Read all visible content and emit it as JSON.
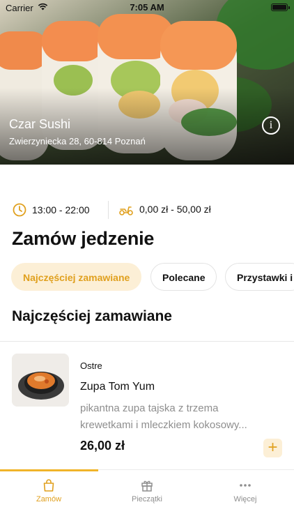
{
  "status_bar": {
    "carrier": "Carrier",
    "time": "7:05 AM"
  },
  "restaurant": {
    "name": "Czar Sushi",
    "address": "Zwierzyniecka 28, 60-814 Poznań",
    "hours": "13:00 - 22:00",
    "delivery_cost": "0,00 zł - 50,00 zł"
  },
  "page": {
    "title": "Zamów jedzenie"
  },
  "categories": [
    {
      "label": "Najczęściej zamawiane",
      "active": true
    },
    {
      "label": "Polecane",
      "active": false
    },
    {
      "label": "Przystawki i",
      "active": false
    }
  ],
  "section": {
    "title": "Najczęściej zamawiane"
  },
  "products": [
    {
      "tag": "Ostre",
      "name": "Zupa Tom Yum",
      "description": "pikantna zupa tajska z trzema krewetkami i mleczkiem kokosowy...",
      "price": "26,00 zł",
      "add_label": "+"
    }
  ],
  "tabbar": {
    "items": [
      {
        "label": "Zamów",
        "icon": "bag-icon",
        "active": true
      },
      {
        "label": "Pieczątki",
        "icon": "gift-icon",
        "active": false
      },
      {
        "label": "Więcej",
        "icon": "more-dots-icon",
        "active": false
      }
    ]
  },
  "colors": {
    "accent": "#f0b429",
    "accent_text": "#e0a01e",
    "accent_bg": "#fcefd6"
  },
  "icons": {
    "info": "info-icon",
    "clock": "clock-icon",
    "scooter": "scooter-icon",
    "wifi": "wifi-icon",
    "battery": "battery-icon"
  }
}
